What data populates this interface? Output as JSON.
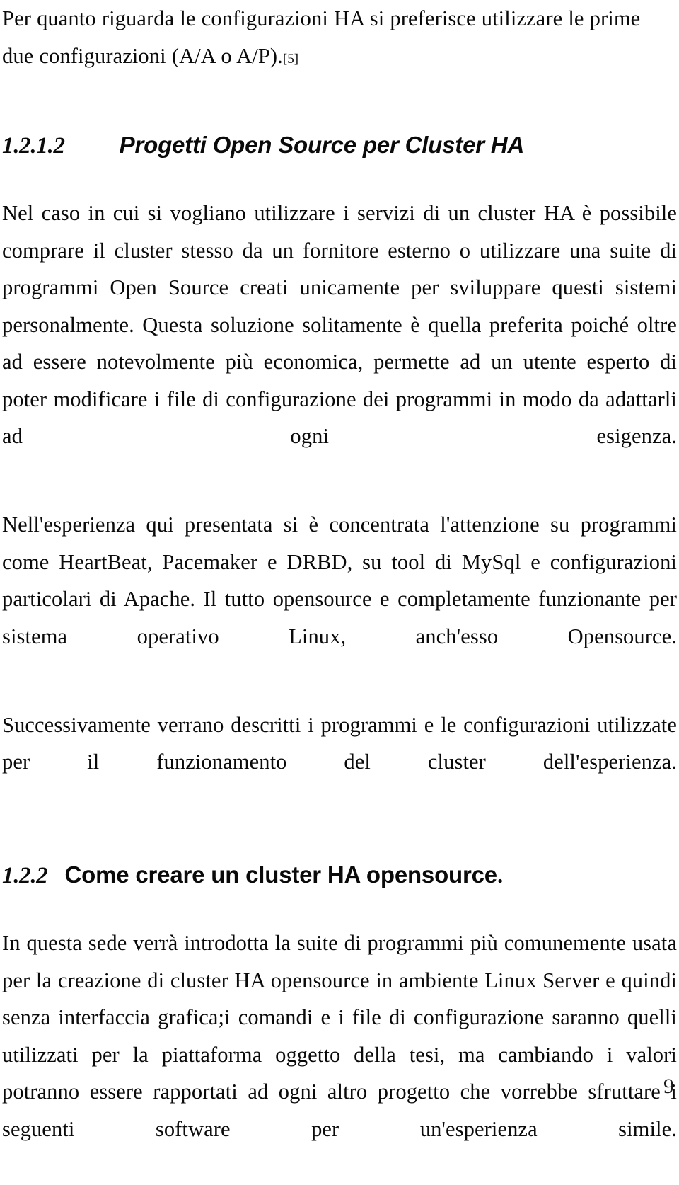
{
  "document": {
    "language": "it",
    "page_number": "9",
    "blocks": [
      {
        "id": "para-1",
        "type": "paragraph",
        "text": "Per quanto riguarda le configurazioni HA si preferisce utilizzare le prime due configurazioni (A/A o A/P).",
        "citation": "[5]"
      },
      {
        "id": "heading-1",
        "type": "heading",
        "number": "1.2.1.2",
        "title": "Progetti Open Source per Cluster HA",
        "style": "italic",
        "trailing_period": ""
      },
      {
        "id": "para-2",
        "type": "paragraph",
        "text": "Nel caso in cui si vogliano utilizzare i servizi di un cluster HA è possibile comprare il cluster stesso da un fornitore esterno o utilizzare una suite di programmi Open Source creati unicamente per sviluppare questi sistemi personalmente. Questa soluzione solitamente è quella preferita poiché oltre ad essere notevolmente più economica, permette ad un utente esperto di poter modificare i file di configurazione dei programmi in modo da adattarli ad ogni esigenza."
      },
      {
        "id": "para-3",
        "type": "paragraph",
        "text": "Nell'esperienza qui presentata si è concentrata l'attenzione su programmi come HeartBeat, Pacemaker e DRBD, su tool di MySql e configurazioni particolari di Apache. Il tutto opensource e completamente funzionante per sistema operativo Linux, anch'esso Opensource."
      },
      {
        "id": "para-4",
        "type": "paragraph",
        "text": "Successivamente verrano descritti i programmi e le configurazioni utilizzate per il funzionamento del cluster dell'esperienza."
      },
      {
        "id": "heading-2",
        "type": "heading",
        "number": "1.2.2",
        "title": "Come creare un cluster HA opensource",
        "style": "upright",
        "trailing_period": "."
      },
      {
        "id": "para-5",
        "type": "paragraph",
        "text": "In questa sede verrà introdotta la suite di programmi più comunemente usata per la creazione di cluster HA opensource in ambiente Linux Server e quindi senza interfaccia grafica;i comandi e i file di configurazione saranno quelli utilizzati per la piattaforma oggetto della tesi, ma cambiando i valori potranno essere rapportati ad ogni altro progetto che vorrebbe sfruttare i seguenti software per un'esperienza simile."
      }
    ]
  }
}
